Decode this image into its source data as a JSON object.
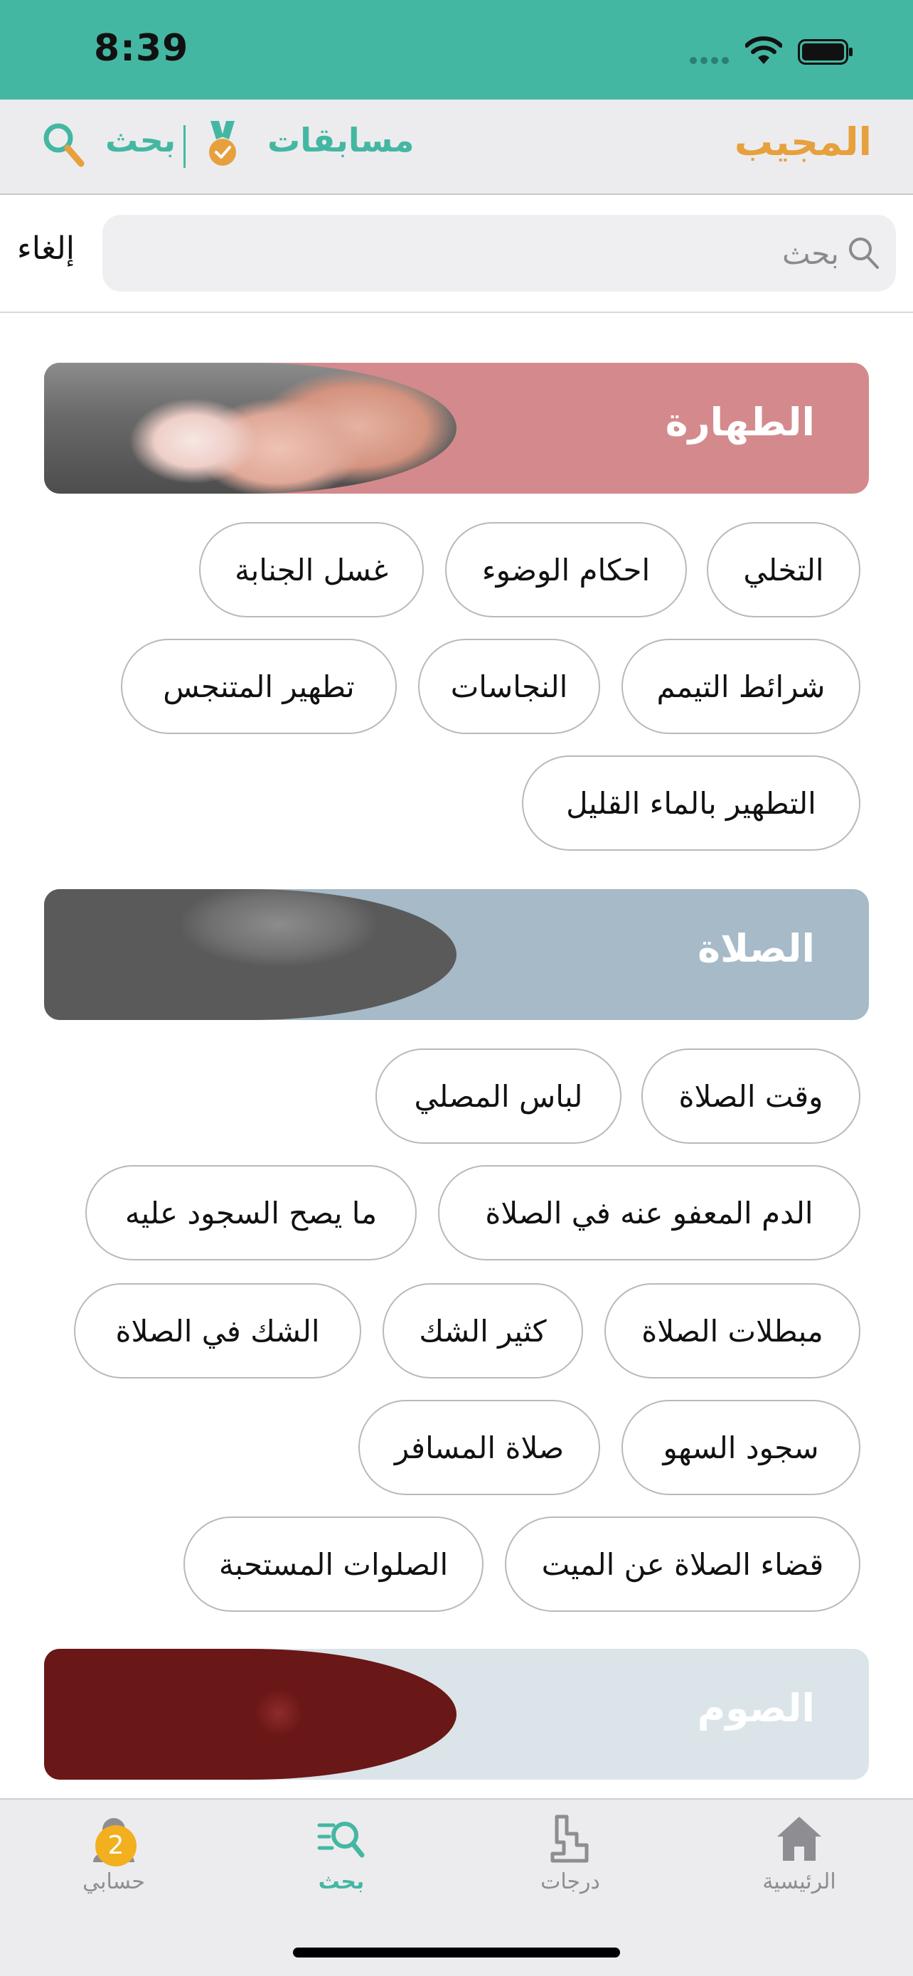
{
  "status_bar": {
    "time": "8:39"
  },
  "header": {
    "brand": "المجيب",
    "contests_label": "مسابقات",
    "search_label": "بحث"
  },
  "search": {
    "placeholder": "بحث",
    "cancel_label": "إلغاء"
  },
  "sections": [
    {
      "title": "الطهارة",
      "color": "#d48a8c",
      "chips": [
        "التخلي",
        "احكام الوضوء",
        "غسل الجنابة",
        "شرائط التيمم",
        "النجاسات",
        "تطهير المتنجس",
        "التطهير بالماء القليل"
      ]
    },
    {
      "title": "الصلاة",
      "color": "#a6bac8",
      "chips": [
        "وقت الصلاة",
        "لباس المصلي",
        "الدم المعفو عنه في الصلاة",
        "ما يصح السجود عليه",
        "مبطلات الصلاة",
        "كثير الشك",
        "الشك في الصلاة",
        "سجود السهو",
        "صلاة المسافر",
        "قضاء الصلاة عن الميت",
        "الصلوات المستحبة"
      ]
    },
    {
      "title": "الصوم",
      "color": "#dbe4e9",
      "chips": []
    }
  ],
  "tabbar": {
    "items": [
      {
        "label": "حسابي",
        "icon": "person-icon",
        "badge": "2"
      },
      {
        "label": "بحث",
        "icon": "search-list-icon",
        "active": true
      },
      {
        "label": "درجات",
        "icon": "stairs-icon"
      },
      {
        "label": "الرئيسية",
        "icon": "home-icon"
      }
    ]
  },
  "colors": {
    "accent": "#44b7a3",
    "brand": "#e6a03d"
  }
}
